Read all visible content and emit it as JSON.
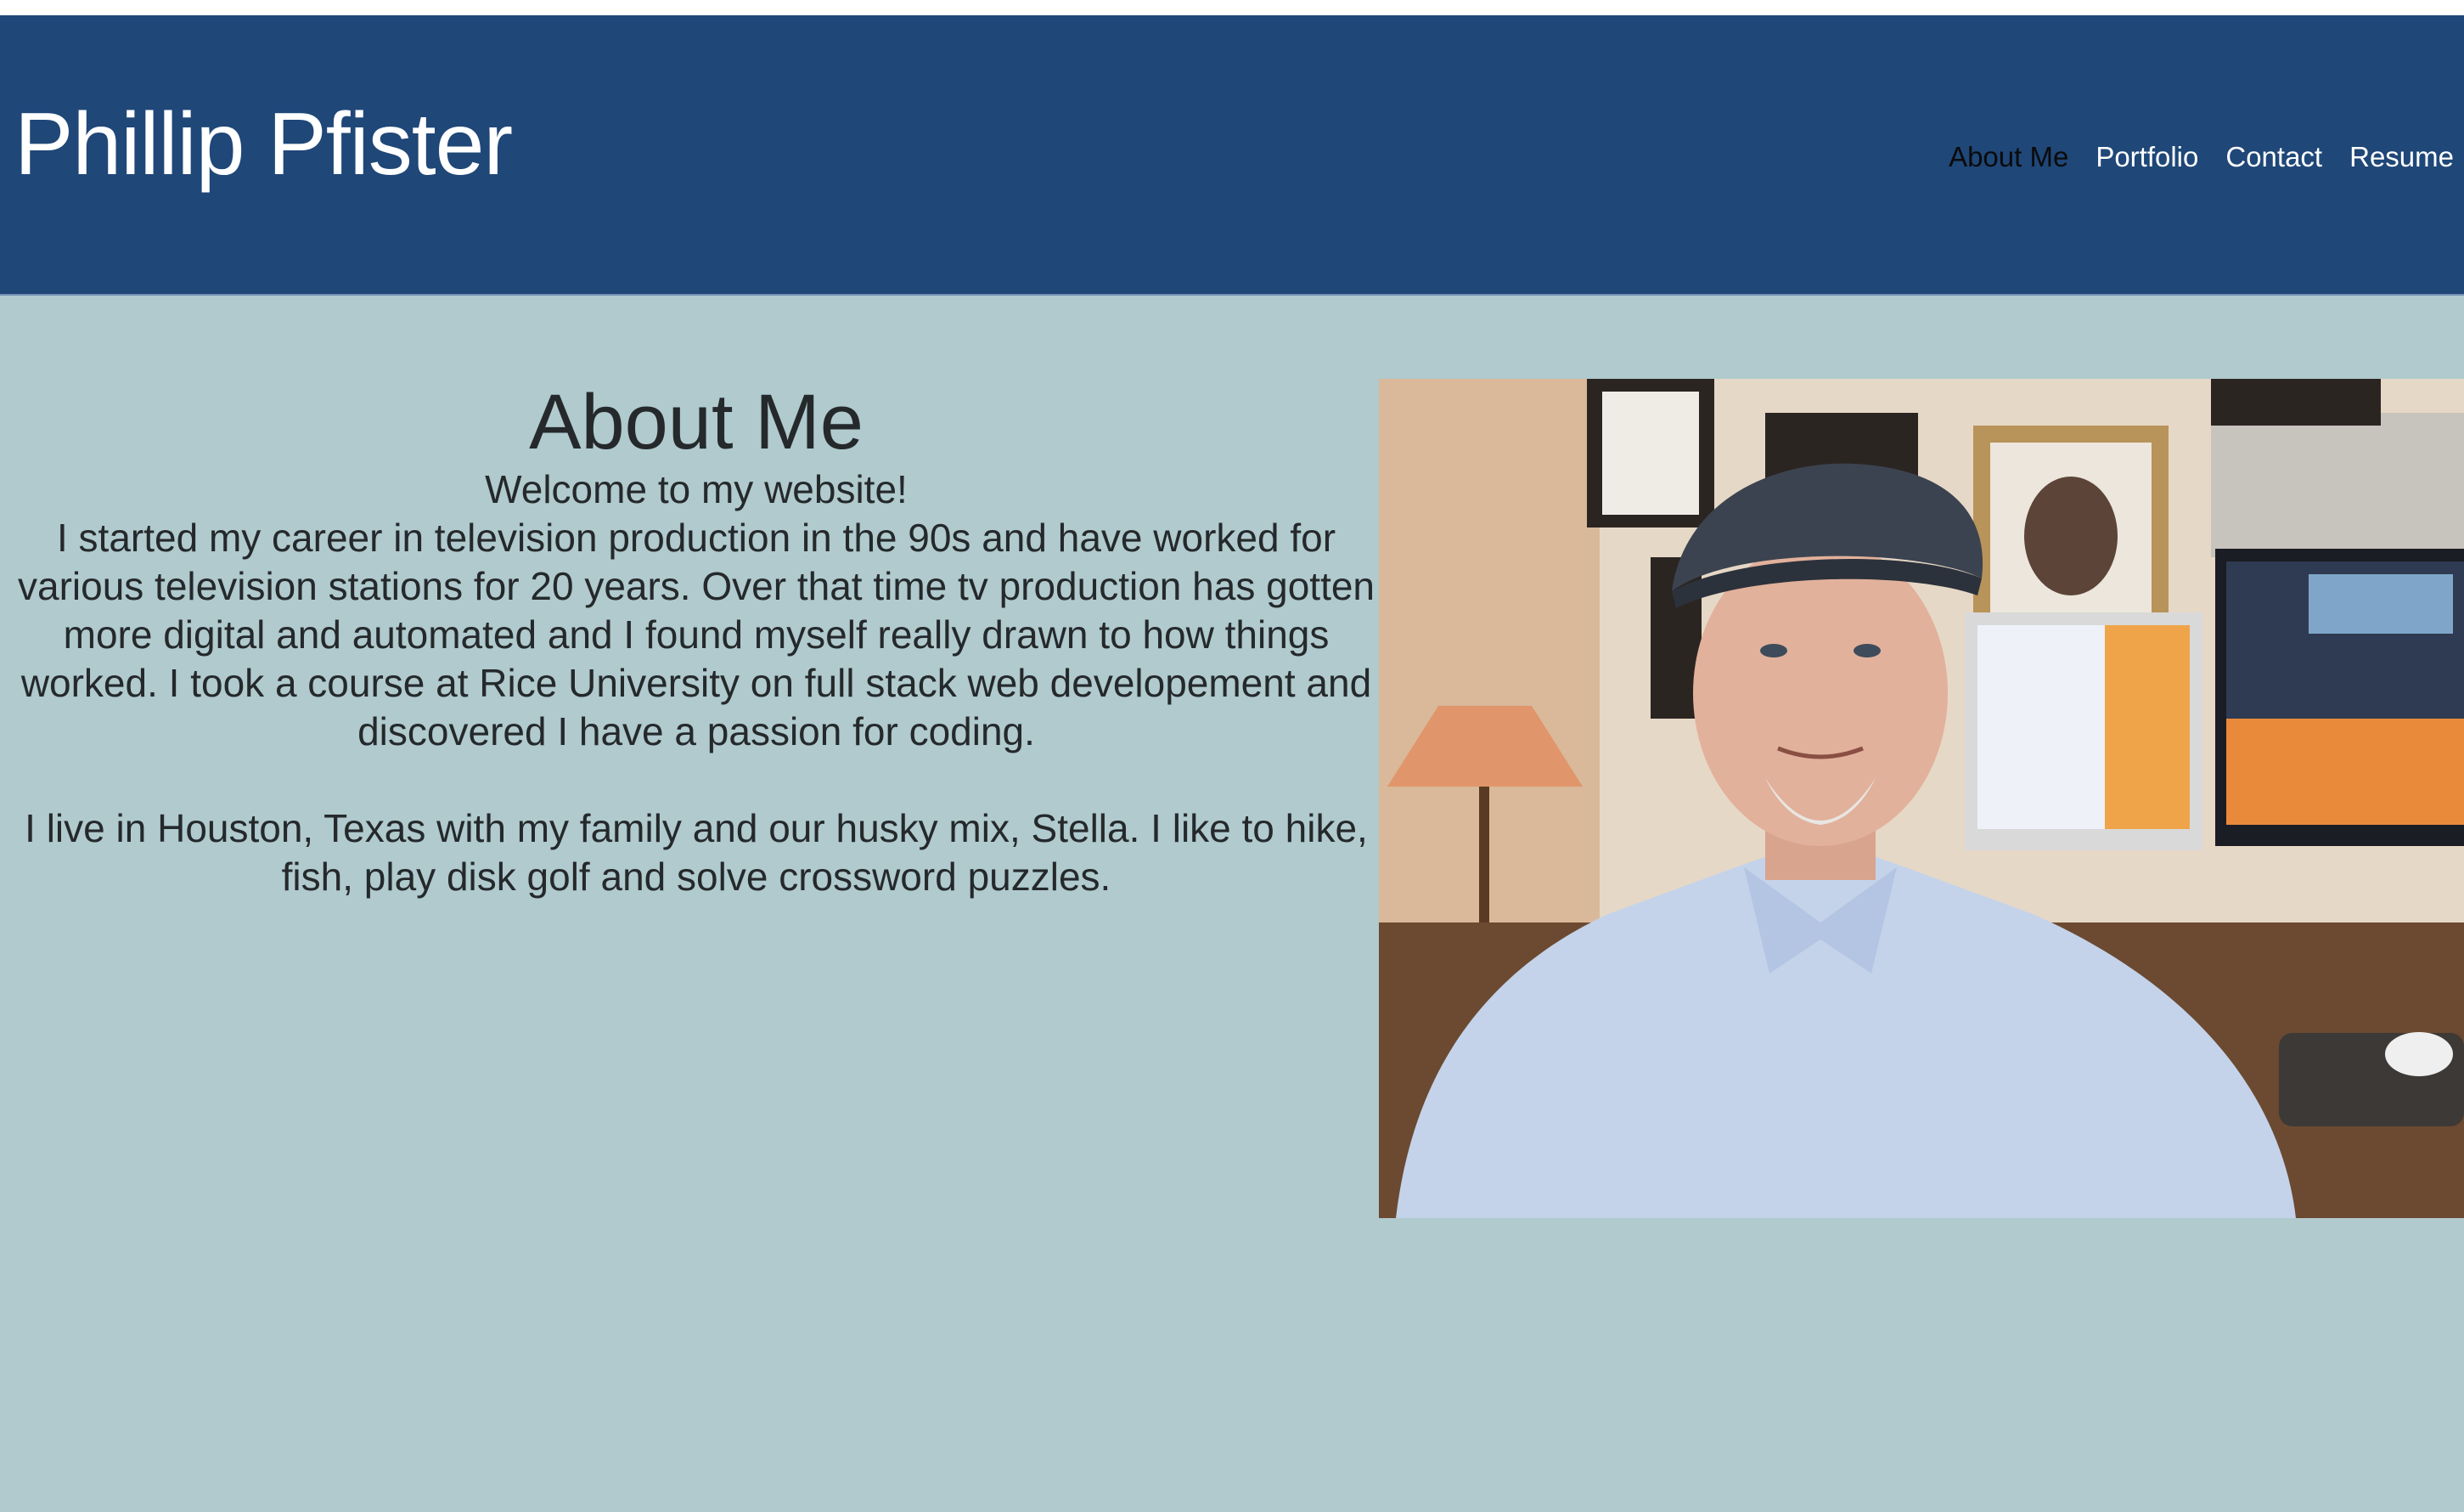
{
  "header": {
    "site_title": "Phillip Pfister",
    "nav": [
      "About Me",
      "Portfolio",
      "Contact",
      "Resume"
    ],
    "active": "About Me"
  },
  "about": {
    "heading": "About Me",
    "welcome": "Welcome to my website!",
    "paragraph_1": "I started my career in television production in the 90s and have worked for various television stations for 20 years. Over that time tv production has gotten more digital and automated and I found myself really drawn to how things worked. I took a course at Rice University on full stack web developement and discovered I have a passion for coding.",
    "paragraph_2": "I live in Houston, Texas with my family and our husky mix, Stella. I like to hike, fish, play disk golf and solve crossword puzzles."
  },
  "colors": {
    "header_bg": "#1f4778",
    "page_bg": "#b0cacd",
    "text": "#25292c",
    "nav_active": "#0b0b0b"
  }
}
